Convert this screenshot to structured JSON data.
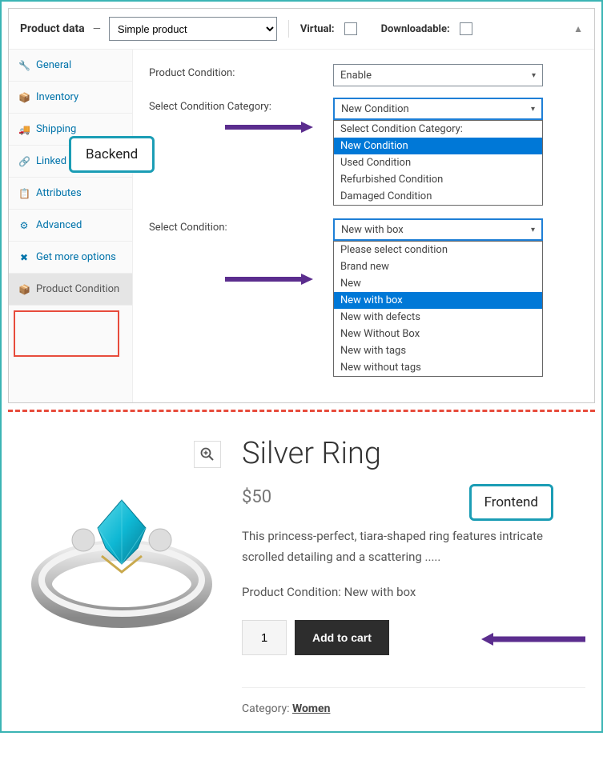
{
  "panel": {
    "title": "Product data",
    "dash": "—",
    "product_type": "Simple product",
    "virtual_label": "Virtual:",
    "downloadable_label": "Downloadable:"
  },
  "sidebar": {
    "items": [
      {
        "icon": "🔧",
        "label": "General"
      },
      {
        "icon": "📦",
        "label": "Inventory"
      },
      {
        "icon": "🚚",
        "label": "Shipping"
      },
      {
        "icon": "🔗",
        "label": "Linked Products"
      },
      {
        "icon": "📋",
        "label": "Attributes"
      },
      {
        "icon": "⚙",
        "label": "Advanced"
      },
      {
        "icon": "✖",
        "label": "Get more options"
      },
      {
        "icon": "📦",
        "label": "Product Condition"
      }
    ]
  },
  "form": {
    "condition_label": "Product Condition:",
    "condition_value": "Enable",
    "category_label": "Select Condition Category:",
    "category_value": "New Condition",
    "category_options": [
      "Select Condition Category:",
      "New Condition",
      "Used Condition",
      "Refurbished Condition",
      "Damaged Condition"
    ],
    "select_condition_label": "Select Condition:",
    "select_condition_value": "New with box",
    "select_condition_options": [
      "Please select condition",
      "Brand new",
      "New",
      "New with box",
      "New with defects",
      "New Without Box",
      "New with tags",
      "New without tags"
    ]
  },
  "callouts": {
    "backend": "Backend",
    "frontend": "Frontend"
  },
  "product": {
    "title": "Silver Ring",
    "price": "$50",
    "description": "This princess-perfect, tiara-shaped ring features intricate scrolled detailing and a scattering .....",
    "condition_label": "Product Condition:",
    "condition_value": "New with box",
    "qty": "1",
    "add_to_cart": "Add to cart",
    "category_label": "Category:",
    "category_value": "Women"
  }
}
